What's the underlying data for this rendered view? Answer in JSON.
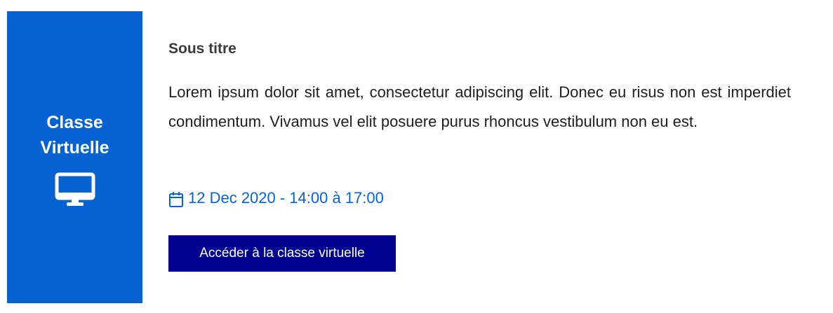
{
  "card": {
    "side": {
      "label_line1": "Classe",
      "label_line2": "Virtuelle",
      "icon": "desktop-monitor-icon",
      "background_color": "#0762d1"
    },
    "subtitle": "Sous titre",
    "body": "Lorem ipsum dolor sit amet, consectetur adipiscing elit. Donec eu risus non est imperdiet condimentum. Vivamus vel elit posuere purus rhoncus vestibulum non eu est.",
    "date": {
      "icon": "calendar-icon",
      "text": "12 Dec 2020 - 14:00 à 17:00",
      "color": "#0762d1"
    },
    "button": {
      "label": "Accéder à la classe virtuelle",
      "background_color": "#000091"
    }
  }
}
